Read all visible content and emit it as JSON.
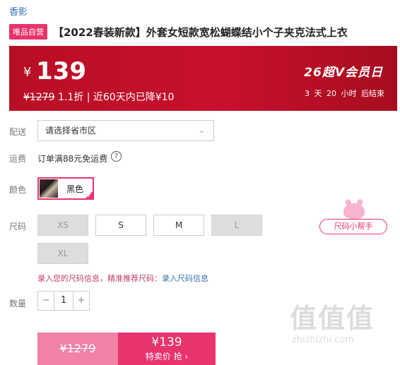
{
  "store": {
    "brand": "香影"
  },
  "product": {
    "tag": "唯品自营",
    "title": "【2022春装新款】外套女短款宽松蝴蝶结小个子夹克法式上衣"
  },
  "price": {
    "currency": "¥",
    "current": "139",
    "original": "¥1279",
    "discount": "1.1折",
    "separator": "|",
    "note": "近60天内已降¥10"
  },
  "promo": {
    "logo_text": "26超V会员日",
    "countdown": "3 天 20 小时 后结束"
  },
  "delivery": {
    "label": "配送",
    "select_value": "请选择省市区"
  },
  "shipping": {
    "label": "运费",
    "text": "订单满88元免运费",
    "help_icon": "question-circle-icon"
  },
  "color": {
    "label": "颜色",
    "option": "黑色"
  },
  "size": {
    "label": "尺码",
    "options": [
      {
        "label": "XS",
        "available": false
      },
      {
        "label": "S",
        "available": true
      },
      {
        "label": "M",
        "available": true
      },
      {
        "label": "L",
        "available": false
      },
      {
        "label": "XL",
        "available": false
      }
    ],
    "helper_label": "尺码小帮手",
    "info_text": "录入您的尺码信息，精准推荐尺码：",
    "info_link": "录入尺码信息"
  },
  "quantity": {
    "label": "数量",
    "value": "1",
    "minus": "−",
    "plus": "+"
  },
  "buy": {
    "original_price": "¥1279",
    "price": "¥139",
    "label": "特卖价 抢 ›"
  },
  "watermark": {
    "chars": "值值值",
    "domain": "zhizhizhi.com"
  },
  "colors": {
    "accent": "#e8336d",
    "banner": "#c8102e",
    "link": "#3a6fb5"
  }
}
